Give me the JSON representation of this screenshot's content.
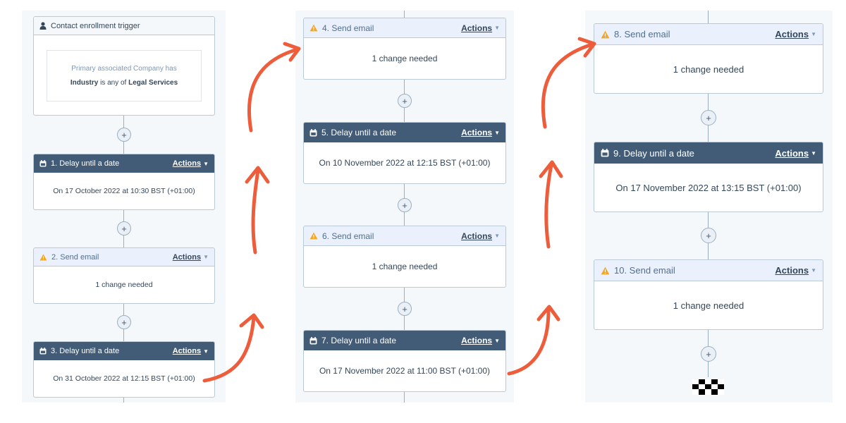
{
  "trigger": {
    "title": "Contact enrollment trigger",
    "filter_line1": "Primary associated Company has",
    "filter_prop": "Industry",
    "filter_op": "is any of",
    "filter_value": "Legal Services"
  },
  "actions_label": "Actions",
  "plus_label": "+",
  "steps": [
    {
      "title": "1. Delay until a date",
      "body": "On 17 October 2022 at 10:30 BST (+01:00)",
      "type": "delay"
    },
    {
      "title": "2. Send email",
      "body": "1 change needed",
      "type": "email"
    },
    {
      "title": "3. Delay until a date",
      "body": "On 31 October 2022 at 12:15 BST (+01:00)",
      "type": "delay"
    },
    {
      "title": "4. Send email",
      "body": "1 change needed",
      "type": "email"
    },
    {
      "title": "5. Delay until a date",
      "body": "On 10 November 2022 at 12:15 BST (+01:00)",
      "type": "delay"
    },
    {
      "title": "6. Send email",
      "body": "1 change needed",
      "type": "email"
    },
    {
      "title": "7. Delay until a date",
      "body": "On 17 November 2022 at 11:00 BST (+01:00)",
      "type": "delay"
    },
    {
      "title": "8. Send email",
      "body": "1 change needed",
      "type": "email"
    },
    {
      "title": "9. Delay until a date",
      "body": "On 17 November 2022 at 13:15 BST (+01:00)",
      "type": "delay"
    },
    {
      "title": "10. Send email",
      "body": "1 change needed",
      "type": "email"
    }
  ],
  "colors": {
    "delay_header": "#425b76",
    "email_header": "#eaf0fc",
    "warning": "#f5a623",
    "arrow": "#ee5d3b",
    "canvas": "#f5f8fa"
  },
  "icons": {
    "trigger": "person-icon",
    "delay": "calendar-icon",
    "email": "warning-icon",
    "actions": "chevron-down-icon",
    "end": "checkered-flag-icon"
  }
}
